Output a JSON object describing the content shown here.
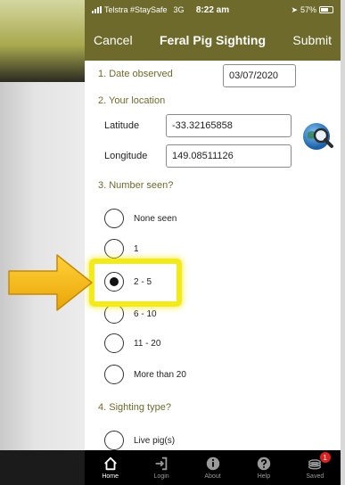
{
  "status_bar": {
    "carrier": "Telstra #StaySafe",
    "network": "3G",
    "time": "8:22 am",
    "battery": "57%"
  },
  "nav": {
    "cancel_label": "Cancel",
    "title": "Feral Pig Sighting",
    "submit_label": "Submit"
  },
  "form": {
    "date_section": "1. Date observed",
    "date_value": "03/07/2020",
    "location_section": "2. Your location",
    "latitude_label": "Latitude",
    "latitude_value": "-33.32165858",
    "longitude_label": "Longitude",
    "longitude_value": "149.08511126",
    "number_section": "3. Number seen?",
    "number_options": [
      {
        "label": "None seen",
        "selected": false
      },
      {
        "label": "1",
        "selected": false
      },
      {
        "label": "2 - 5",
        "selected": true
      },
      {
        "label": "6 - 10",
        "selected": false
      },
      {
        "label": "11 - 20",
        "selected": false
      },
      {
        "label": "More than 20",
        "selected": false
      }
    ],
    "sighting_section": "4. Sighting type?",
    "sighting_options": [
      {
        "label": "Live pig(s)",
        "selected": false
      }
    ]
  },
  "tabs": [
    {
      "label": "Home",
      "icon": "home-icon",
      "active": true
    },
    {
      "label": "Login",
      "icon": "login-icon",
      "active": false
    },
    {
      "label": "About",
      "icon": "info-icon",
      "active": false
    },
    {
      "label": "Help",
      "icon": "help-icon",
      "active": false
    },
    {
      "label": "Saved",
      "icon": "saved-icon",
      "active": false,
      "badge": "1"
    }
  ],
  "colors": {
    "header": "#6e6a2c",
    "highlight": "#f3ea1a",
    "arrow": "#f2b90f",
    "tab_bar": "#000000",
    "badge": "#e0201d"
  }
}
